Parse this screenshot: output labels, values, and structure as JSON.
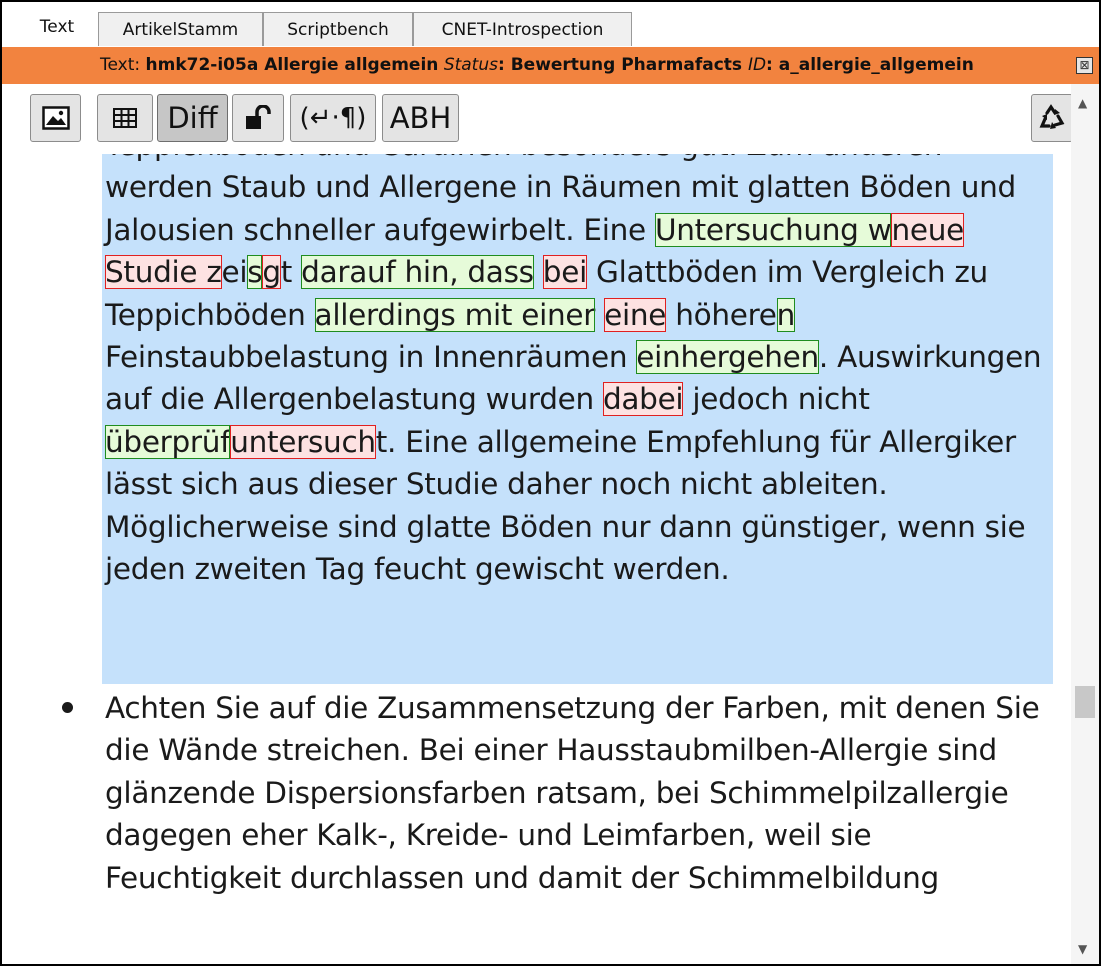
{
  "tabs": [
    {
      "label": "Text",
      "active": true
    },
    {
      "label": "ArtikelStamm",
      "active": false
    },
    {
      "label": "Scriptbench",
      "active": false
    },
    {
      "label": "CNET-Introspection",
      "active": false
    }
  ],
  "status": {
    "prefix": "Text: ",
    "text_id": "hmk72-i05a Allergie allgemein",
    "status_label": "Status",
    "status_value": ": Bewertung Pharmafacts ",
    "id_label": "ID",
    "id_value": ": a_allergie_allgemein",
    "close": "⊠",
    "color": "#f2833f"
  },
  "toolbar": {
    "diff_label": "Diff",
    "pilcrow_label": "(↵·¶)",
    "abh_label": "ABH",
    "icons": [
      "image-icon",
      "table-icon",
      "lock-open-icon",
      "recycle-icon"
    ]
  },
  "colors": {
    "selection": "#c5e1fb",
    "inserted_bg": "#e6fbd9",
    "inserted_border": "#1f8c1f",
    "deleted_bg": "#fde2e2",
    "deleted_border": "#e02020"
  },
  "content": {
    "p1": [
      {
        "t": "Teppichböden und Gardinen besonders gut. Zum anderen werden Staub und Allergene in Räumen mit glatten Böden und Jalousien schneller aufgewirbelt. Eine ",
        "k": "n"
      },
      {
        "t": "Untersuchung w",
        "k": "i"
      },
      {
        "t": "neue Studie z",
        "k": "d"
      },
      {
        "t": "ei",
        "k": "n"
      },
      {
        "t": "s",
        "k": "i"
      },
      {
        "t": "g",
        "k": "d"
      },
      {
        "t": "t ",
        "k": "n"
      },
      {
        "t": "darauf hin, dass",
        "k": "i"
      },
      {
        "t": " ",
        "k": "n"
      },
      {
        "t": "bei",
        "k": "d"
      },
      {
        "t": " Glattböden im Vergleich zu Teppichböden ",
        "k": "n"
      },
      {
        "t": "allerdings mit einer",
        "k": "i"
      },
      {
        "t": " ",
        "k": "n"
      },
      {
        "t": "eine",
        "k": "d"
      },
      {
        "t": " höhere",
        "k": "n"
      },
      {
        "t": "n",
        "k": "i"
      },
      {
        "t": " Feinstaubbelastung in Innenräumen ",
        "k": "n"
      },
      {
        "t": "einhergehen",
        "k": "i"
      },
      {
        "t": ". Auswirkungen auf die Allergenbelastung wurden ",
        "k": "n"
      },
      {
        "t": "dabei",
        "k": "d"
      },
      {
        "t": " jedoch nicht ",
        "k": "n"
      },
      {
        "t": "überprüf",
        "k": "i"
      },
      {
        "t": "untersuch",
        "k": "d"
      },
      {
        "t": "t. Eine allgemeine Empfehlung für Allergiker lässt sich aus dieser Studie daher noch nicht ableiten. Möglicherweise sind glatte Böden nur dann günstiger, wenn sie jeden zweiten Tag feucht gewischt werden.",
        "k": "n"
      }
    ],
    "p2": "Achten Sie auf die Zusammensetzung der Farben, mit denen Sie die Wände streichen. Bei einer Hausstaubmilben-Allergie sind glänzende Dispersionsfarben ratsam, bei Schimmelpilzallergie dagegen eher Kalk-, Kreide- und Leimfarben, weil sie Feuchtigkeit durchlassen und damit der Schimmelbildung"
  }
}
